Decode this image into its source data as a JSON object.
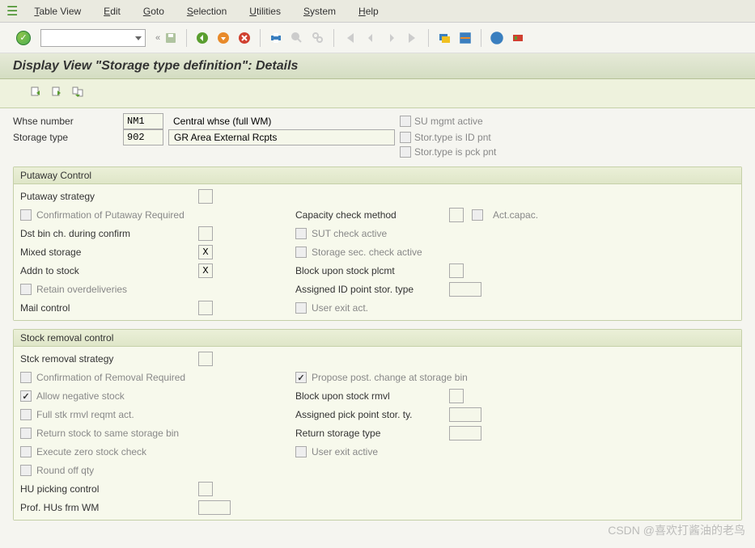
{
  "menu": {
    "items": [
      "Table View",
      "Edit",
      "Goto",
      "Selection",
      "Utilities",
      "System",
      "Help"
    ]
  },
  "title": "Display View \"Storage type definition\": Details",
  "header": {
    "whse_label": "Whse number",
    "whse_value": "NM1",
    "whse_desc": "Central whse (full WM)",
    "stype_label": "Storage type",
    "stype_value": "902",
    "stype_desc": "GR Area External Rcpts",
    "flags": {
      "su_mgmt": "SU mgmt active",
      "id_pnt": "Stor.type is ID pnt",
      "pck_pnt": "Stor.type is pck pnt"
    }
  },
  "putaway": {
    "title": "Putaway Control",
    "left": {
      "strategy": "Putaway strategy",
      "confirm_req": "Confirmation of Putaway Required",
      "dst_bin": "Dst bin ch. during confirm",
      "mixed": "Mixed storage",
      "mixed_val": "X",
      "addn": "Addn to stock",
      "addn_val": "X",
      "retain": "Retain overdeliveries",
      "mail": "Mail control"
    },
    "right": {
      "cap_check": "Capacity check method",
      "act_capac": "Act.capac.",
      "sut_check": "SUT check active",
      "stor_sec": "Storage sec. check active",
      "block_plc": "Block upon stock plcmt",
      "assigned_id": "Assigned ID point stor. type",
      "user_exit": "User exit act."
    }
  },
  "removal": {
    "title": "Stock removal control",
    "left": {
      "strategy": "Stck removal strategy",
      "confirm_req": "Confirmation of Removal Required",
      "neg_stock": "Allow negative stock",
      "full_stk": "Full stk rmvl reqmt act.",
      "return_same": "Return stock to same storage bin",
      "zero_check": "Execute zero stock check",
      "round_off": "Round off qty",
      "hu_picking": "HU picking control",
      "prof_hu": "Prof. HUs frm WM"
    },
    "right": {
      "propose_post": "Propose post. change at storage bin",
      "block_rmvl": "Block upon stock rmvl",
      "assigned_pick": "Assigned pick point stor. ty.",
      "return_storage": "Return storage type",
      "user_exit_active": "User exit active"
    }
  },
  "watermark": "CSDN @喜欢打酱油的老鸟"
}
